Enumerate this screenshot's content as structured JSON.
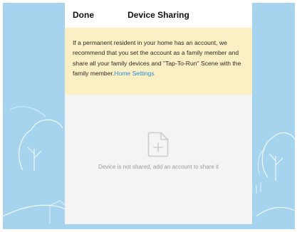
{
  "header": {
    "done_label": "Done",
    "title": "Device Sharing"
  },
  "notice": {
    "text": "If a permanent resident in your home has an account, we recommend that you set the account as a family member and share all your family devices and \"Tap-To-Run\" Scene with the family member.",
    "link_label": "Home Settings"
  },
  "empty_state": {
    "icon": "file-add-icon",
    "message": "Device is not shared, add an account to share it"
  },
  "colors": {
    "backdrop": "#a6d3ee",
    "notice_bg": "#fbf0c4",
    "link": "#2b8bd6"
  }
}
